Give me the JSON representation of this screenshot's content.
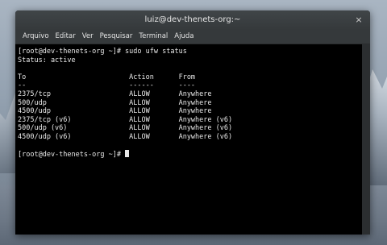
{
  "window": {
    "title": "luiz@dev-thenets-org:~",
    "close_glyph": "×"
  },
  "menu": [
    {
      "label": "Arquivo"
    },
    {
      "label": "Editar"
    },
    {
      "label": "Ver"
    },
    {
      "label": "Pesquisar"
    },
    {
      "label": "Terminal"
    },
    {
      "label": "Ajuda"
    }
  ],
  "terminal": {
    "lines": [
      "[root@dev-thenets-org ~]# sudo ufw status",
      "Status: active",
      "",
      "To                         Action      From",
      "--                         ------      ----",
      "2375/tcp                   ALLOW       Anywhere",
      "500/udp                    ALLOW       Anywhere",
      "4500/udp                   ALLOW       Anywhere",
      "2375/tcp (v6)              ALLOW       Anywhere (v6)",
      "500/udp (v6)               ALLOW       Anywhere (v6)",
      "4500/udp (v6)              ALLOW       Anywhere (v6)",
      ""
    ],
    "prompt": "[root@dev-thenets-org ~]# "
  }
}
